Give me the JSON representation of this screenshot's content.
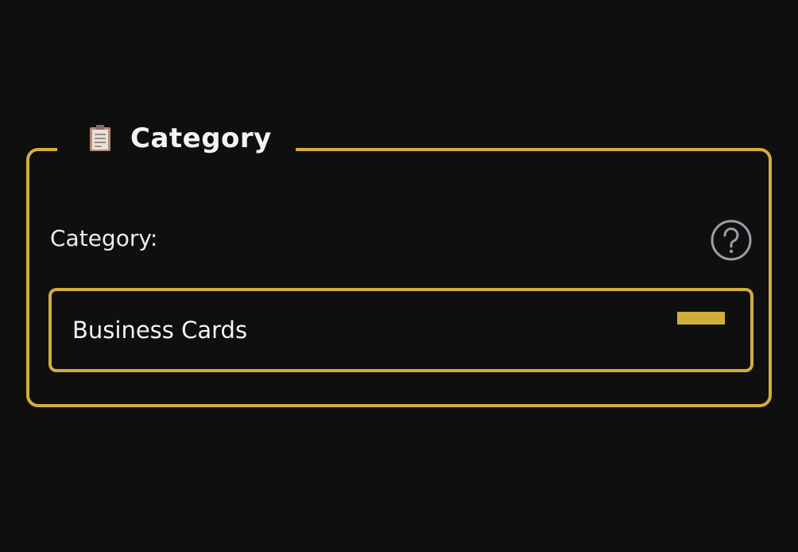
{
  "panel": {
    "title": "Category",
    "icon": "clipboard-icon"
  },
  "field": {
    "label": "Category:",
    "help_icon": "question-circle-icon",
    "selected_value": "Business Cards"
  },
  "colors": {
    "background": "#0f0f0f",
    "accent": "#d1ad3b",
    "text": "#f4f4f4",
    "help_icon": "#9aa0a8"
  }
}
